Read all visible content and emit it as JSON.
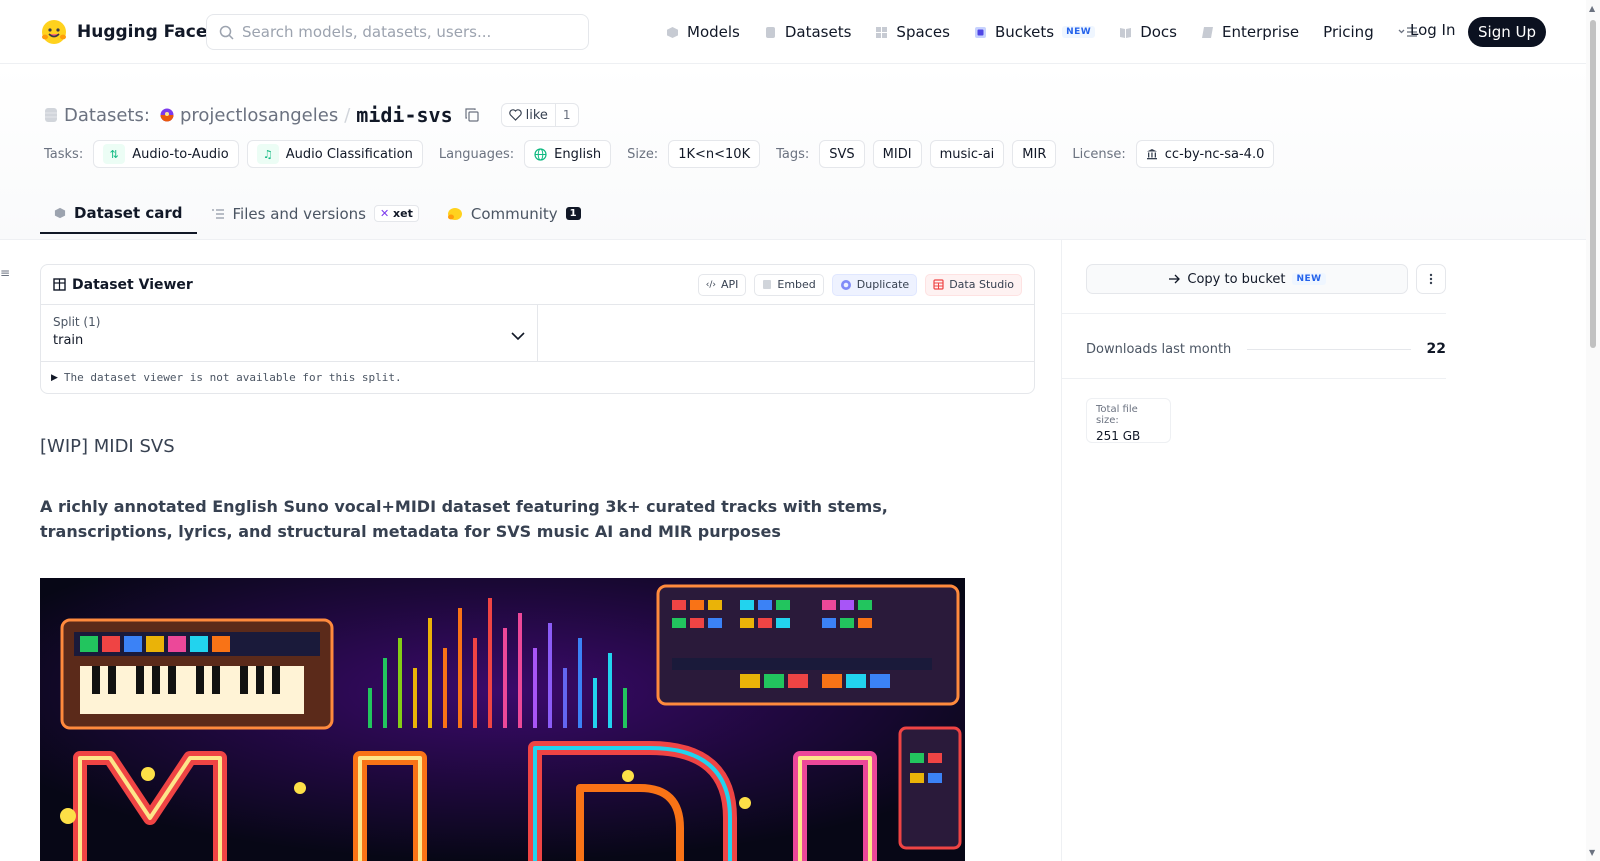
{
  "brand": {
    "name": "Hugging Face"
  },
  "search": {
    "placeholder": "Search models, datasets, users..."
  },
  "nav": {
    "items": [
      {
        "label": "Models"
      },
      {
        "label": "Datasets"
      },
      {
        "label": "Spaces"
      },
      {
        "label": "Buckets",
        "badge": "NEW"
      },
      {
        "label": "Docs"
      },
      {
        "label": "Enterprise"
      },
      {
        "label": "Pricing"
      }
    ],
    "login": "Log In",
    "signup": "Sign Up"
  },
  "repo": {
    "type_label": "Datasets:",
    "owner": "projectlosangeles",
    "name": "midi-svs",
    "like_label": "like",
    "like_count": "1"
  },
  "tags": {
    "tasks_label": "Tasks:",
    "tasks": [
      "Audio-to-Audio",
      "Audio Classification"
    ],
    "languages_label": "Languages:",
    "language": "English",
    "size_label": "Size:",
    "size": "1K<n<10K",
    "tags_label": "Tags:",
    "tags": [
      "SVS",
      "MIDI",
      "music-ai",
      "MIR"
    ],
    "license_label": "License:",
    "license": "cc-by-nc-sa-4.0"
  },
  "tabs": [
    {
      "label": "Dataset card"
    },
    {
      "label": "Files and versions",
      "badge": "xet"
    },
    {
      "label": "Community",
      "count": "1"
    }
  ],
  "viewer": {
    "title": "Dataset Viewer",
    "actions": {
      "api": "API",
      "embed": "Embed",
      "duplicate": "Duplicate",
      "data_studio": "Data Studio"
    },
    "split_label": "Split (1)",
    "split_value": "train",
    "message": "The dataset viewer is not available for this split."
  },
  "card": {
    "heading": "[WIP] MIDI SVS",
    "lead": "A richly annotated English Suno vocal+MIDI dataset featuring 3k+ curated tracks with stems, transcriptions, lyrics, and structural metadata for SVS music AI and MIR purposes"
  },
  "sidebar": {
    "copy_label": "Copy to bucket",
    "copy_badge": "NEW",
    "downloads_label": "Downloads last month",
    "downloads_value": "22",
    "size_label": "Total file size:",
    "size_value": "251 GB"
  },
  "colors": {
    "accent_green": "#10b981",
    "badge_blue": "#2563eb",
    "dark": "#0b1120"
  }
}
